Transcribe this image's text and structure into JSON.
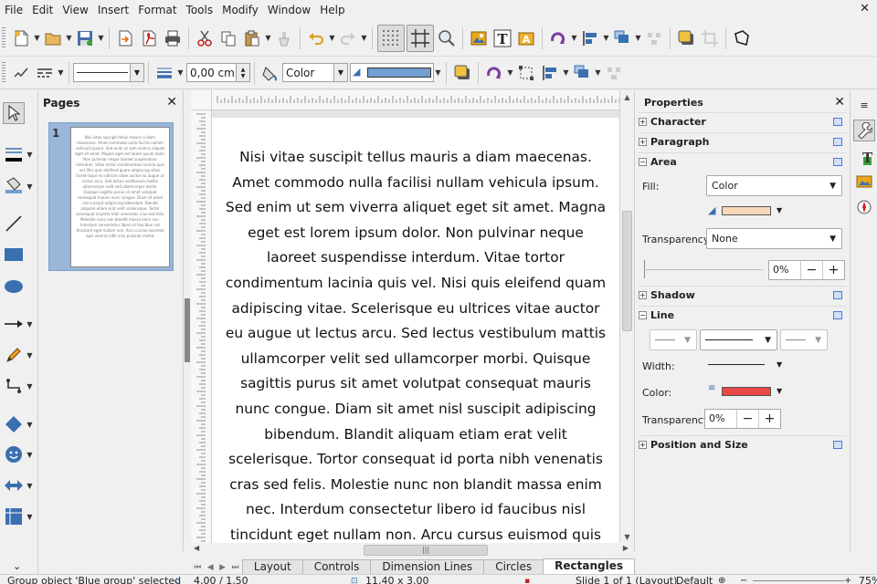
{
  "menu": [
    "File",
    "Edit",
    "View",
    "Insert",
    "Format",
    "Tools",
    "Modify",
    "Window",
    "Help"
  ],
  "toolbar2": {
    "line_width": "0,00 cm",
    "area_style": "Color",
    "area_color": "#729fcf"
  },
  "pages_panel": {
    "title": "Pages",
    "page_number": "1"
  },
  "document": {
    "text": "Nisi vitae suscipit tellus mauris a diam maecenas. Amet commodo nulla facilisi nullam vehicula ipsum. Sed enim ut sem viverra aliquet eget sit amet. Magna eget est lorem ipsum dolor. Non pulvinar neque laoreet suspendisse interdum. Vitae tortor condimentum lacinia quis vel. Nisi quis eleifend quam adipiscing vitae. Scelerisque eu ultrices vitae auctor eu augue ut lectus arcu. Sed lectus vestibulum mattis ullamcorper velit sed ullamcorper morbi. Quisque sagittis purus sit amet volutpat consequat mauris nunc congue. Diam sit amet nisl suscipit adipiscing bibendum. Blandit aliquam etiam erat velit scelerisque. Tortor consequat id porta nibh venenatis cras sed felis. Molestie nunc non blandit massa enim nec. Interdum consectetur libero id faucibus nisl tincidunt eget nullam non. Arcu cursus euismod quis viverra nibh cras pulvinar mattis"
  },
  "tabs": [
    "Layout",
    "Controls",
    "Dimension Lines",
    "Circles",
    "Rectangles"
  ],
  "active_tab": "Rectangles",
  "properties": {
    "title": "Properties",
    "sections": {
      "character": "Character",
      "paragraph": "Paragraph",
      "area": "Area",
      "shadow": "Shadow",
      "line": "Line",
      "position_size": "Position and Size"
    },
    "area": {
      "fill_label": "Fill:",
      "fill_value": "Color",
      "fill_color": "#f7d9b8",
      "transparency_label": "Transparency:",
      "transparency_value": "None",
      "transparency_percent": "0%"
    },
    "line": {
      "width_label": "Width:",
      "color_label": "Color:",
      "line_color": "#e84848",
      "transparency_label": "Transparency:",
      "transparency_value": "0%"
    }
  },
  "status": {
    "selection": "Group object 'Blue group' selected",
    "position": "4,00 / 1,50",
    "size": "11,40 x 3,00",
    "slide": "Slide 1 of 1 (Layout)",
    "master": "Default",
    "zoom": "75%"
  },
  "colors": {
    "accent_blue": "#4a7bd0",
    "pressed_bg": "#dcdcdc"
  }
}
